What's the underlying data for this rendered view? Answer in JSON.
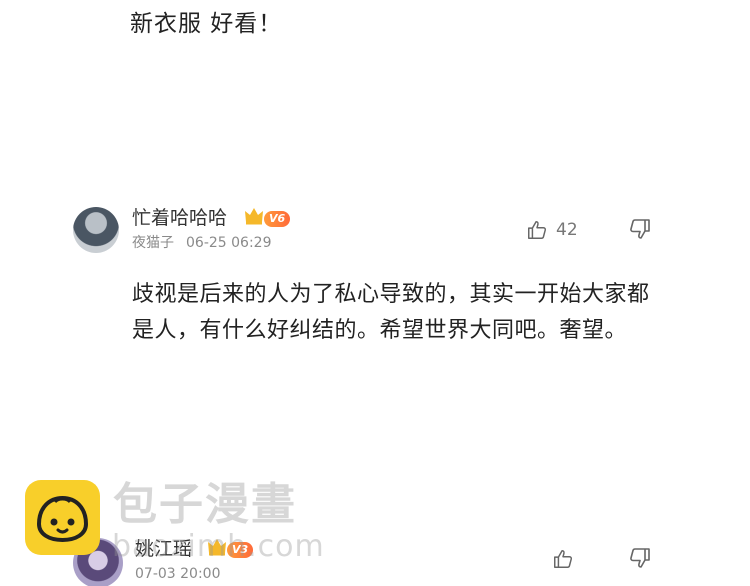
{
  "top_comment": {
    "text": "新衣服 好看！"
  },
  "comments": [
    {
      "username": "忙着哈哈哈",
      "level": "V6",
      "source": "夜猫子",
      "time": "06-25 06:29",
      "likes": "42",
      "body": "歧视是后来的人为了私心导致的，其实一开始大家都是人，有什么好纠结的。希望世界大同吧。奢望。"
    },
    {
      "username": "姚江瑶",
      "level": "V3",
      "time": "07-03 20:00"
    }
  ],
  "watermark": {
    "brand": "包子漫畫",
    "url": "baozimh.com"
  },
  "colors": {
    "level_badge": "#ff7a3a",
    "crown": "#f5b82a",
    "watermark_logo": "#f8cf2a"
  }
}
